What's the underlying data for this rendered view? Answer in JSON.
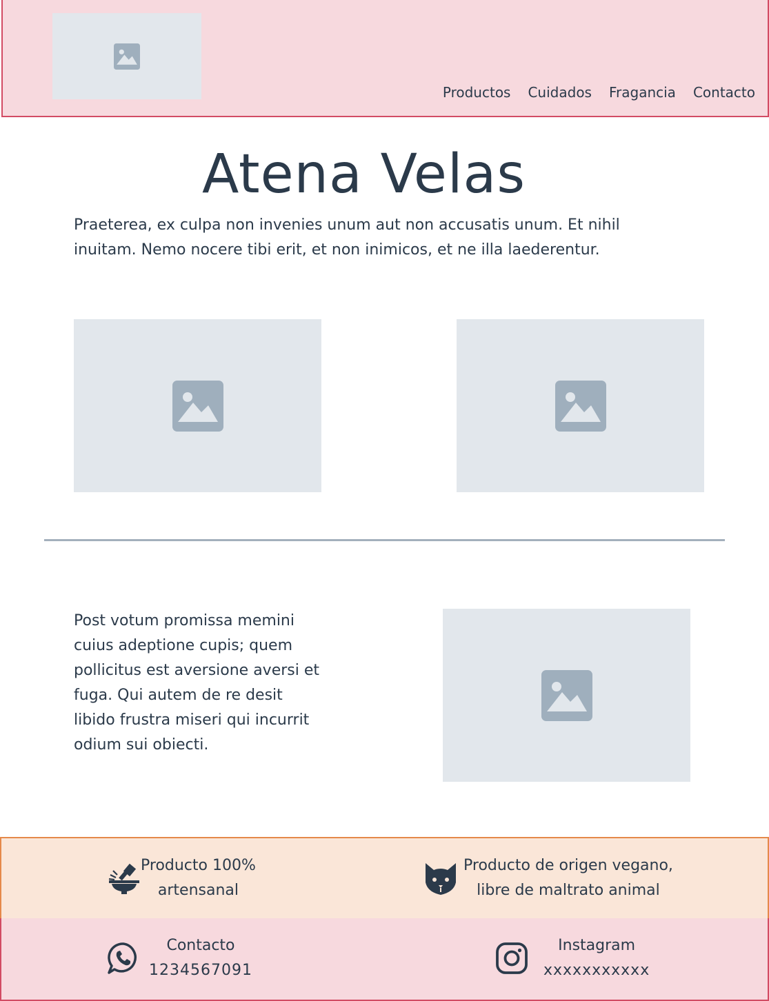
{
  "header": {
    "nav": [
      "Productos",
      "Cuidados",
      "Fragancia",
      "Contacto"
    ]
  },
  "hero": {
    "title": "Atena Velas",
    "intro": "Praeterea, ex culpa non invenies unum aut non accusatis unum. Et nihil inuitam. Nemo nocere tibi erit, et non inimicos, et ne illa laederentur."
  },
  "section2": {
    "text": "Post votum promissa memini cuius adeptione cupis; quem pollicitus est aversione aversi et fuga. Qui autem de re desit libido frustra miseri qui incurrit odium sui obiecti."
  },
  "features": {
    "handmade": {
      "icon": "mortar-pestle-icon",
      "line1": "Producto 100%",
      "line2": "artensanal"
    },
    "vegan": {
      "icon": "cat-icon",
      "line1": "Producto de origen vegano,",
      "line2": "libre de maltrato animal"
    }
  },
  "contact": {
    "phone": {
      "icon": "whatsapp-icon",
      "label": "Contacto",
      "value": "1234567091"
    },
    "instagram": {
      "icon": "instagram-icon",
      "label": "Instagram",
      "value": "xxxxxxxxxxx"
    }
  },
  "colors": {
    "header_bg": "#f7d9de",
    "header_border": "#d24b63",
    "features_bg": "#fae6d8",
    "features_border": "#e5894a",
    "placeholder_bg": "#e2e7ec",
    "placeholder_icon": "#9fafbd",
    "text": "#2b3a4a"
  }
}
